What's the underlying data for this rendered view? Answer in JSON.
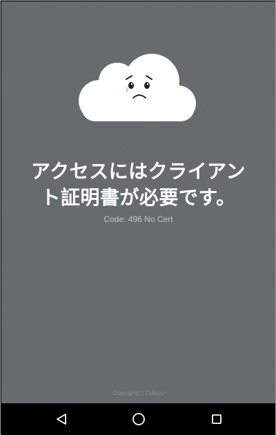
{
  "error": {
    "message_line1": "アクセスにはクライアン",
    "message_line2": "ト証明書が必要です。",
    "code": "Code: 496 No Cert",
    "copyright": "Copyright(C) Cybozu"
  },
  "icons": {
    "illustration": "sad-cloud-icon",
    "nav_back": "back-triangle-icon",
    "nav_home": "home-circle-icon",
    "nav_recents": "recents-square-icon"
  },
  "colors": {
    "background": "#656b6e",
    "text": "#ffffff",
    "code_text": "#c3c6c8",
    "navbar": "#000000"
  }
}
